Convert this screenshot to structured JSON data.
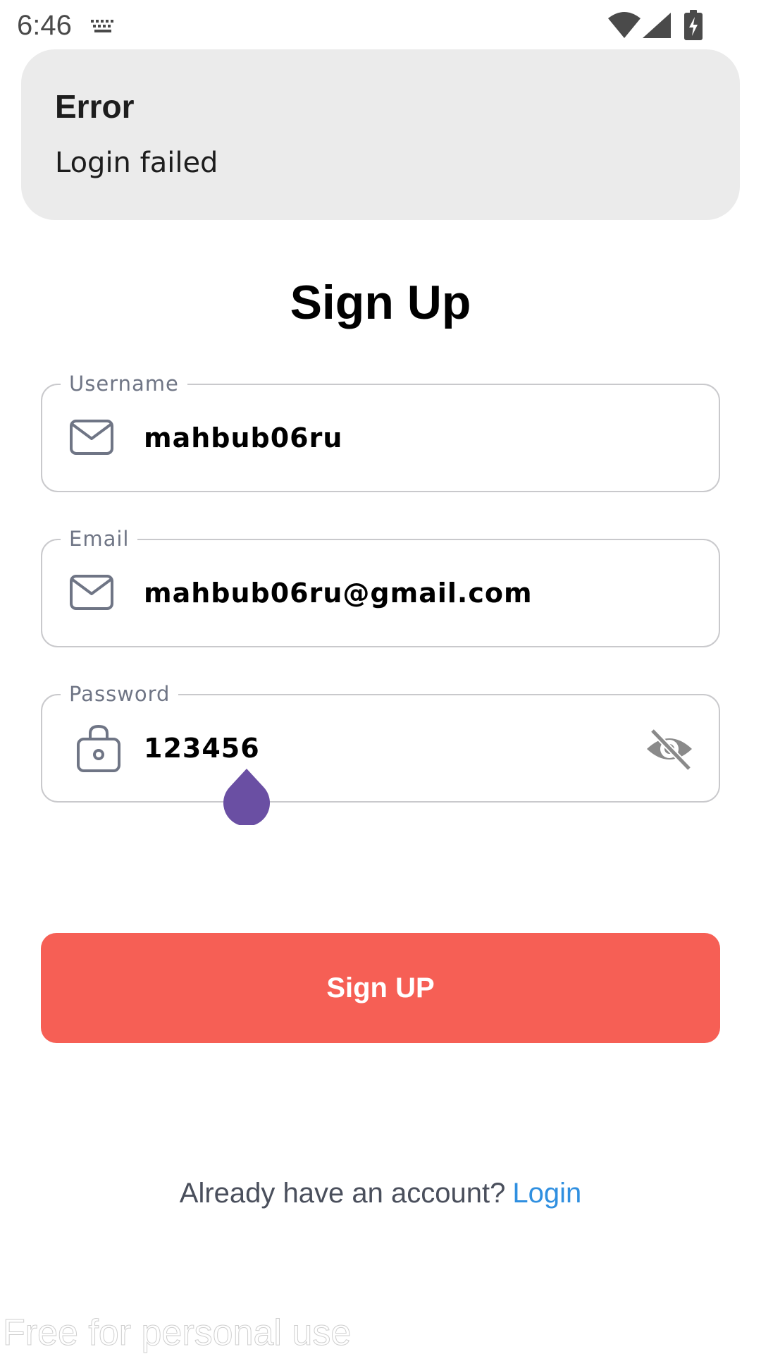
{
  "status_bar": {
    "time": "6:46",
    "icons": [
      "keyboard-icon",
      "wifi-icon",
      "signal-icon",
      "battery-charging-icon"
    ]
  },
  "snackbar": {
    "title": "Error",
    "message": "Login failed",
    "background": "#ebebeb"
  },
  "form": {
    "title": "Sign Up",
    "username": {
      "label": "Username",
      "value": "mahbub06ru",
      "icon": "mail-icon"
    },
    "email": {
      "label": "Email",
      "value": "mahbub06ru@gmail.com",
      "icon": "mail-icon"
    },
    "password": {
      "label": "Password",
      "value": "123456",
      "icon": "lock-icon",
      "toggle_icon": "visibility-off-icon"
    },
    "submit_label": "Sign UP",
    "submit_color": "#f65f55"
  },
  "footer": {
    "prompt": "Already have an account?",
    "login_link": "Login",
    "link_color": "#2f8fe0"
  },
  "watermark": "Free for personal use",
  "colors": {
    "cursor_handle": "#6a4fa3",
    "field_label": "#6f7585"
  }
}
